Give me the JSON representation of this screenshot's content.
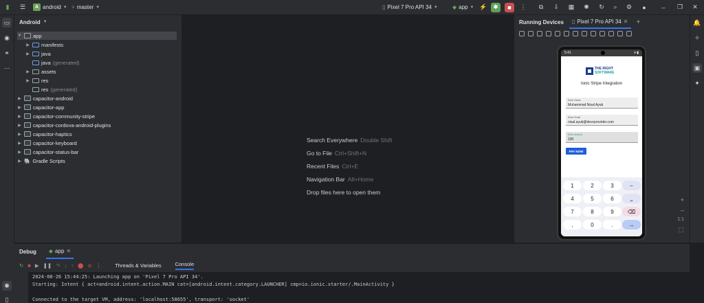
{
  "titlebar": {
    "project_badge": "A",
    "project_name": "android",
    "branch": "master",
    "device": "Pixel 7 Pro API 34",
    "run_config": "app"
  },
  "project_panel": {
    "title": "Android",
    "tree": [
      {
        "label": "app",
        "suffix": ""
      },
      {
        "label": "manifests",
        "suffix": ""
      },
      {
        "label": "java",
        "suffix": ""
      },
      {
        "label": "java",
        "suffix": "(generated)"
      },
      {
        "label": "assets",
        "suffix": ""
      },
      {
        "label": "res",
        "suffix": ""
      },
      {
        "label": "res",
        "suffix": "(generated)"
      },
      {
        "label": "capacitor-android",
        "suffix": ""
      },
      {
        "label": "capacitor-app",
        "suffix": ""
      },
      {
        "label": "capacitor-community-stripe",
        "suffix": ""
      },
      {
        "label": "capacitor-cordova-android-plugins",
        "suffix": ""
      },
      {
        "label": "capacitor-haptics",
        "suffix": ""
      },
      {
        "label": "capacitor-keyboard",
        "suffix": ""
      },
      {
        "label": "capacitor-status-bar",
        "suffix": ""
      },
      {
        "label": "Gradle Scripts",
        "suffix": ""
      }
    ]
  },
  "editor": {
    "hints": [
      {
        "label": "Search Everywhere",
        "key": "Double Shift"
      },
      {
        "label": "Go to File",
        "key": "Ctrl+Shift+N"
      },
      {
        "label": "Recent Files",
        "key": "Ctrl+E"
      },
      {
        "label": "Navigation Bar",
        "key": "Alt+Home"
      },
      {
        "label": "Drop files here to open them",
        "key": ""
      }
    ]
  },
  "devices_panel": {
    "title": "Running Devices",
    "tab": "Pixel 7 Pro API 34",
    "zoom_label": "1:1"
  },
  "phone": {
    "time": "5:41",
    "logo_line1": "THE RIGHT",
    "logo_line2": "SOFTWARE",
    "app_title": "Ionic Stripe Integration",
    "fields": [
      {
        "label": "Enter Name",
        "value": "Muhammad Nisal Ayub"
      },
      {
        "label": "Enter Email",
        "value": "nisal.ayub@devcprovider.com"
      },
      {
        "label": "Enter Amount",
        "value": "100"
      }
    ],
    "pay_button": "PAY NOW",
    "keys": [
      "1",
      "2",
      "3",
      "−",
      "4",
      "5",
      "6",
      "⎵",
      "7",
      "8",
      "9",
      "⌫",
      ",",
      "0",
      ".",
      "→"
    ]
  },
  "debug": {
    "title": "Debug",
    "tab": "app",
    "subtabs": [
      "Threads & Variables",
      "Console"
    ],
    "console_lines": [
      "2024-08-26 15:44:25: Launching app on 'Pixel 7 Pro API 34'.",
      "Starting: Intent { act=android.intent.action.MAIN cat=[android.intent.category.LAUNCHER] cmp=io.ionic.starter/.MainActivity }",
      "",
      "Connected to the target VM, address: 'localhost:58655', transport: 'socket'"
    ]
  }
}
